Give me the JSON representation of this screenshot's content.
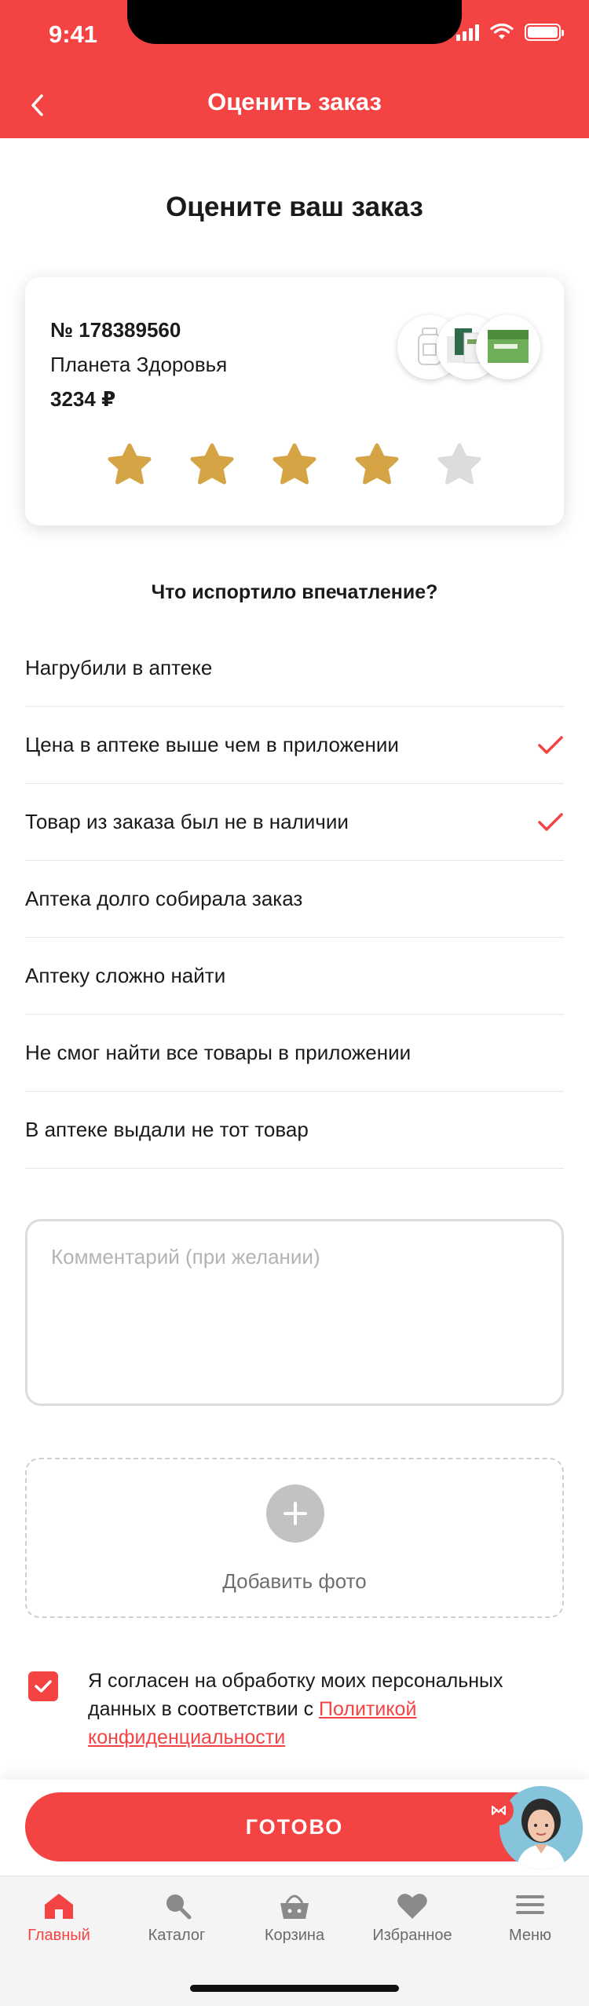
{
  "status_bar": {
    "time": "9:41"
  },
  "header": {
    "title": "Оценить заказ"
  },
  "page": {
    "title": "Оцените ваш заказ"
  },
  "order": {
    "number": "№ 178389560",
    "pharmacy": "Планета Здоровья",
    "price": "3234 ₽",
    "rating": 4,
    "max_rating": 5
  },
  "impression": {
    "title": "Что испортило впечатление?",
    "reasons": [
      {
        "label": "Нагрубили в аптеке",
        "checked": false
      },
      {
        "label": "Цена в аптеке выше чем в приложении",
        "checked": true
      },
      {
        "label": "Товар из заказа был не в наличии",
        "checked": true
      },
      {
        "label": "Аптека долго собирала заказ",
        "checked": false
      },
      {
        "label": "Аптеку сложно найти",
        "checked": false
      },
      {
        "label": "Не смог найти все товары в приложении",
        "checked": false
      },
      {
        "label": "В аптеке выдали не тот товар",
        "checked": false
      }
    ]
  },
  "comment": {
    "placeholder": "Комментарий (при желании)",
    "value": ""
  },
  "photo": {
    "label": "Добавить фото"
  },
  "consent": {
    "checked": true,
    "text": "Я согласен на обработку моих персональных данных в соответствии с",
    "link": "Политикой конфиденциальности"
  },
  "actions": {
    "done_label": "ГОТОВО"
  },
  "tabbar": {
    "items": [
      {
        "label": "Главный",
        "icon": "home-icon",
        "active": true
      },
      {
        "label": "Каталог",
        "icon": "catalog-icon",
        "active": false
      },
      {
        "label": "Корзина",
        "icon": "basket-icon",
        "active": false
      },
      {
        "label": "Избранное",
        "icon": "heart-icon",
        "active": false
      },
      {
        "label": "Меню",
        "icon": "menu-icon",
        "active": false
      }
    ]
  },
  "colors": {
    "accent": "#f44343",
    "star_filled": "#d4a445",
    "star_empty": "#dcdcdc"
  }
}
